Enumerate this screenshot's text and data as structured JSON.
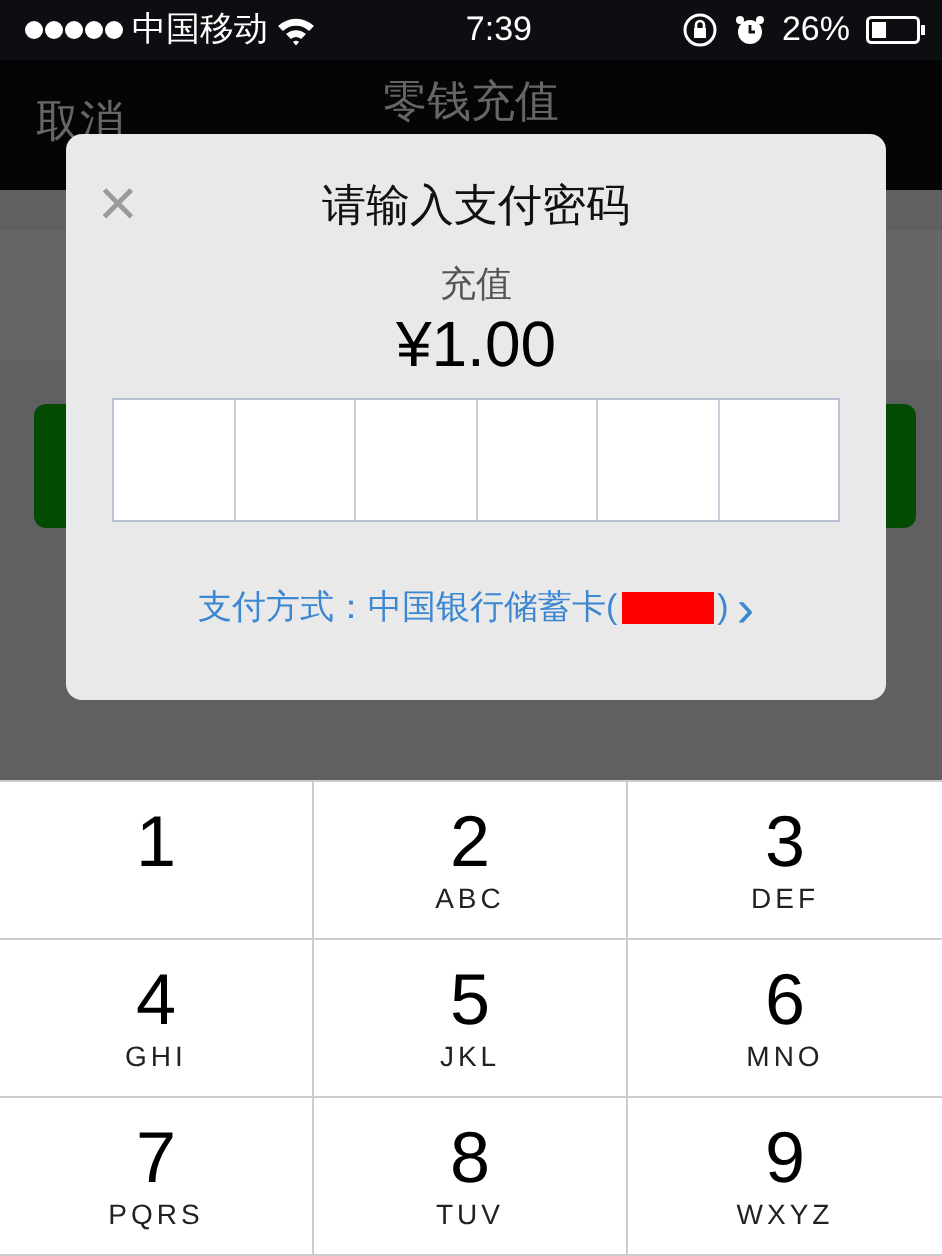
{
  "status_bar": {
    "carrier": "中国移动",
    "time": "7:39",
    "battery": "26%"
  },
  "nav": {
    "cancel": "取消",
    "title": "零钱充值"
  },
  "dialog": {
    "close": "×",
    "title": "请输入支付密码",
    "subtitle": "充值",
    "amount": "¥1.00",
    "password_cells": [
      {
        "filled": false
      },
      {
        "filled": false
      },
      {
        "filled": false
      },
      {
        "filled": false
      },
      {
        "filled": false
      },
      {
        "filled": false
      }
    ],
    "payment_method": {
      "label": "支付方式：中国银行储蓄卡(",
      "close_paren": ")",
      "chevron": "›"
    }
  },
  "keypad": [
    {
      "digit": "1"
    },
    {
      "digit": "2",
      "letters": "ABC"
    },
    {
      "digit": "3",
      "letters": "DEF"
    },
    {
      "digit": "4",
      "letters": "GHI"
    },
    {
      "digit": "5",
      "letters": "JKL"
    },
    {
      "digit": "6",
      "letters": "MNO"
    },
    {
      "digit": "7",
      "letters": "PQRS"
    },
    {
      "digit": "8",
      "letters": "TUV"
    },
    {
      "digit": "9",
      "letters": "WXYZ"
    }
  ]
}
